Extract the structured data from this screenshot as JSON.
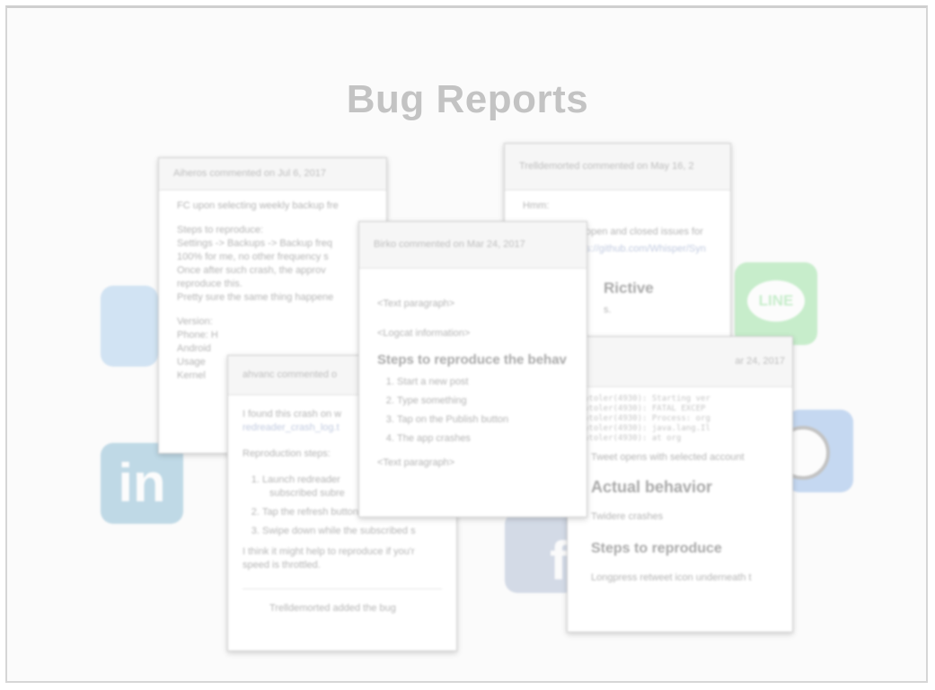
{
  "slide": {
    "title": "Bug Reports"
  },
  "icons": {
    "line_label": "LINE",
    "linkedin_label": "in",
    "facebook_label": "f"
  },
  "card1": {
    "header": "Aiheros commented on Jul 6, 2017",
    "lines": [
      "FC upon selecting weekly backup fre",
      "Steps to reproduce:",
      "Settings -> Backups -> Backup freq",
      "100% for me, no other frequency s",
      "Once after such crash, the approv",
      "reproduce this.",
      "Pretty sure the same thing happene",
      "Version:",
      "Phone: H",
      "Android",
      "Usage",
      "Kernel"
    ]
  },
  "card2": {
    "header": "Trelldemorted commented on May 16, 2",
    "lines": [
      "Hmm:",
      "open and closed issues for",
      "s://github.com/Whisper/Syn"
    ],
    "heading": "Rictive",
    "after": "s."
  },
  "card3": {
    "header": "ahvanc commented o",
    "intro": "I found this crash on w",
    "link": "redreader_crash_log.t",
    "steps_label": "Reproduction steps:",
    "steps": [
      "Launch redreader",
      "subscribed subre",
      "Tap the refresh button in the app ac",
      "Swipe down while the subscribed s"
    ],
    "footer": "I think it might help to reproduce if you'r",
    "footer2": "speed is throttled.",
    "bottom": "Trelldemorted added the bug"
  },
  "card4": {
    "header": "Birko commented on Mar 24, 2017",
    "para1": "<Text paragraph>",
    "para2": "<Logcat information>",
    "heading": "Steps to reproduce the behav",
    "steps": [
      "Start a new post",
      "Type something",
      "Tap on the Publish button",
      "The app crashes"
    ],
    "para3": "<Text paragraph>"
  },
  "card5": {
    "header": "ar 24, 2017",
    "log": [
      "atoler(4930): Starting ver",
      "atoler(4930): FATAL EXCEP",
      "atoler(4930): Process: org",
      "atoler(4930): java.lang.Il",
      "atoler(4930):        at org"
    ],
    "line1": "Tweet opens with selected account",
    "heading1": "Actual behavior",
    "line2": "Twidere crashes",
    "heading2": "Steps to reproduce",
    "line3": "Longpress retweet icon underneath t"
  }
}
